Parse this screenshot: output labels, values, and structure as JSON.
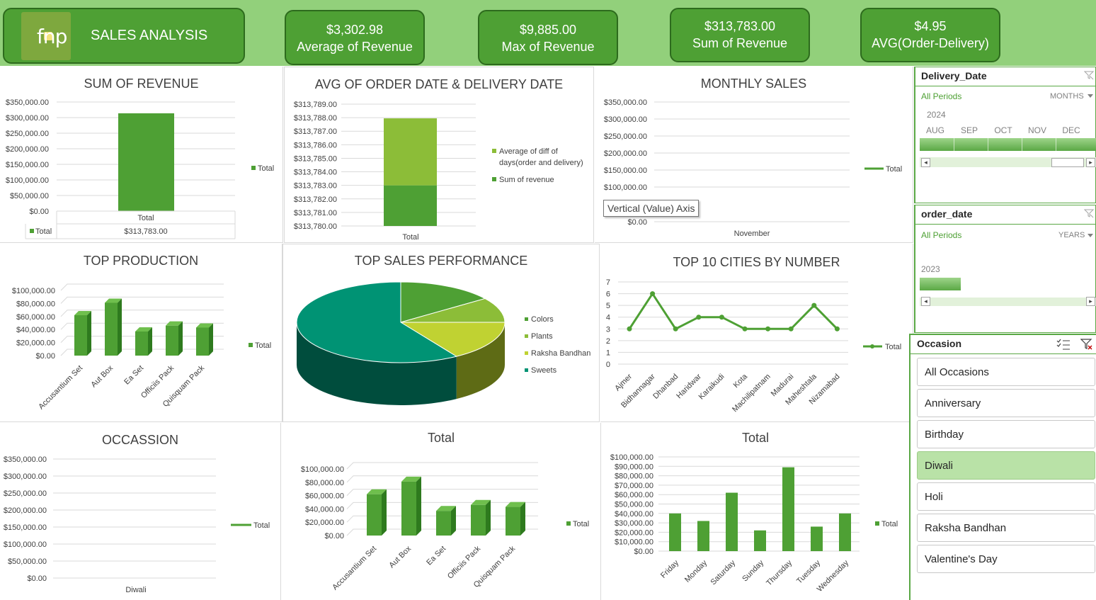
{
  "header": {
    "logo_text": "fnp",
    "title": "SALES ANALYSIS",
    "kpis": [
      {
        "value": "$3,302.98",
        "label": "Average of Revenue"
      },
      {
        "value": "$9,885.00",
        "label": "Max of Revenue"
      },
      {
        "value": "$313,783.00",
        "label": "Sum of Revenue"
      },
      {
        "value": "$4.95",
        "label": "AVG(Order-Delivery)"
      }
    ]
  },
  "panels": {
    "sum_revenue": {
      "title": "SUM OF REVENUE",
      "legend": "Total",
      "table_header": "Total",
      "table_row_label": "Total",
      "table_value": "$313,783.00"
    },
    "avg_dates": {
      "title": "AVG OF ORDER DATE & DELIVERY DATE",
      "legend_1_line1": "Average of diff of",
      "legend_1_line2": "days(order and delivery)",
      "legend_2": "Sum of revenue"
    },
    "monthly_sales": {
      "title": "MONTHLY SALES",
      "legend": "Total",
      "tooltip": "Vertical (Value) Axis"
    },
    "top_production": {
      "title": "TOP PRODUCTION",
      "legend": "Total"
    },
    "top_sales": {
      "title": "TOP SALES PERFORMANCE"
    },
    "top_cities": {
      "title": "TOP 10 CITIES BY NUMBER",
      "legend": "Total"
    },
    "occasion_chart": {
      "title": "OCCASSION",
      "legend": "Total"
    },
    "total_products": {
      "title": "Total",
      "legend": "Total"
    },
    "total_days": {
      "title": "Total",
      "legend": "Total"
    }
  },
  "slicers": {
    "delivery_date": {
      "title": "Delivery_Date",
      "all_label": "All Periods",
      "unit": "MONTHS",
      "year": "2024",
      "months": [
        "AUG",
        "SEP",
        "OCT",
        "NOV",
        "DEC"
      ]
    },
    "order_date": {
      "title": "order_date",
      "all_label": "All Periods",
      "unit": "YEARS",
      "year": "2023"
    },
    "occasion": {
      "title": "Occasion",
      "items": [
        "All Occasions",
        "Anniversary",
        "Birthday",
        "Diwali",
        "Holi",
        "Raksha Bandhan",
        "Valentine's Day"
      ],
      "selected": "Diwali"
    }
  },
  "colors": {
    "header_band": "#92d07b",
    "card": "#4ea034",
    "bar": "#4ea034",
    "light_green": "#8cbd38",
    "teal": "#009374",
    "yellow_green": "#c0d232"
  },
  "chart_data": [
    {
      "name": "SUM OF REVENUE",
      "type": "bar",
      "categories": [
        "Total"
      ],
      "series": [
        {
          "name": "Total",
          "values": [
            313783
          ]
        }
      ],
      "y_ticks": [
        "$0.00",
        "$50,000.00",
        "$100,000.00",
        "$150,000.00",
        "$200,000.00",
        "$250,000.00",
        "$300,000.00",
        "$350,000.00"
      ],
      "ylim": [
        0,
        350000
      ]
    },
    {
      "name": "AVG OF ORDER DATE & DELIVERY DATE",
      "type": "bar",
      "stacked": true,
      "categories": [
        "Total"
      ],
      "series": [
        {
          "name": "Sum of revenue",
          "values": [
            313783
          ]
        },
        {
          "name": "Average of diff of days(order and delivery)",
          "values": [
            4.95
          ]
        }
      ],
      "y_ticks": [
        "$313,780.00",
        "$313,781.00",
        "$313,782.00",
        "$313,783.00",
        "$313,784.00",
        "$313,785.00",
        "$313,786.00",
        "$313,787.00",
        "$313,788.00",
        "$313,789.00"
      ],
      "ylim": [
        313780,
        313789
      ],
      "x_tick": "Total"
    },
    {
      "name": "MONTHLY SALES",
      "type": "line",
      "categories": [
        "November"
      ],
      "series": [
        {
          "name": "Total",
          "values": []
        }
      ],
      "y_ticks": [
        "$0.00",
        "$100,000.00",
        "$150,000.00",
        "$200,000.00",
        "$250,000.00",
        "$300,000.00",
        "$350,000.00"
      ]
    },
    {
      "name": "TOP PRODUCTION",
      "type": "bar",
      "categories": [
        "Accusantium Set",
        "Aut Box",
        "Ea Set",
        "Officiis Pack",
        "Quisquam Pack"
      ],
      "series": [
        {
          "name": "Total",
          "values": [
            62000,
            81000,
            37000,
            46000,
            43000
          ]
        }
      ],
      "y_ticks": [
        "$0.00",
        "$20,000.00",
        "$40,000.00",
        "$60,000.00",
        "$80,000.00",
        "$100,000.00"
      ],
      "ylim": [
        0,
        100000
      ]
    },
    {
      "name": "TOP SALES PERFORMANCE",
      "type": "pie",
      "categories": [
        "Colors",
        "Plants",
        "Raksha Bandhan",
        "Sweets"
      ],
      "values": [
        15,
        10,
        16,
        59
      ]
    },
    {
      "name": "TOP 10 CITIES BY NUMBER",
      "type": "line",
      "categories": [
        "Ajmer",
        "Bidhannagar",
        "Dhanbad",
        "Haridwar",
        "Karaikudi",
        "Kota",
        "Machilipatnam",
        "Madurai",
        "Maheshtala",
        "Nizamabad"
      ],
      "series": [
        {
          "name": "Total",
          "values": [
            3,
            6,
            3,
            4,
            4,
            3,
            3,
            3,
            5,
            3
          ]
        }
      ],
      "y_ticks": [
        "0",
        "1",
        "2",
        "3",
        "4",
        "5",
        "6",
        "7"
      ],
      "ylim": [
        0,
        7
      ]
    },
    {
      "name": "OCCASSION",
      "type": "line",
      "categories": [
        "Diwali"
      ],
      "series": [
        {
          "name": "Total",
          "values": []
        }
      ],
      "y_ticks": [
        "$0.00",
        "$50,000.00",
        "$100,000.00",
        "$150,000.00",
        "$200,000.00",
        "$250,000.00",
        "$300,000.00",
        "$350,000.00"
      ]
    },
    {
      "name": "Total (products)",
      "type": "bar",
      "categories": [
        "Accusantium Set",
        "Aut Box",
        "Ea Set",
        "Officiis Pack",
        "Quisquam Pack"
      ],
      "series": [
        {
          "name": "Total",
          "values": [
            62000,
            81000,
            37000,
            46000,
            43000
          ]
        }
      ],
      "y_ticks": [
        "$0.00",
        "$20,000.00",
        "$40,000.00",
        "$60,000.00",
        "$80,000.00",
        "$100,000.00"
      ],
      "ylim": [
        0,
        100000
      ]
    },
    {
      "name": "Total (weekdays)",
      "type": "bar",
      "categories": [
        "Friday",
        "Monday",
        "Saturday",
        "Sunday",
        "Thursday",
        "Tuesday",
        "Wednesday"
      ],
      "series": [
        {
          "name": "Total",
          "values": [
            40000,
            32000,
            62000,
            22000,
            89000,
            26000,
            40000
          ]
        }
      ],
      "y_ticks": [
        "$0.00",
        "$10,000.00",
        "$20,000.00",
        "$30,000.00",
        "$40,000.00",
        "$50,000.00",
        "$60,000.00",
        "$70,000.00",
        "$80,000.00",
        "$90,000.00",
        "$100,000.00"
      ],
      "ylim": [
        0,
        100000
      ]
    }
  ]
}
